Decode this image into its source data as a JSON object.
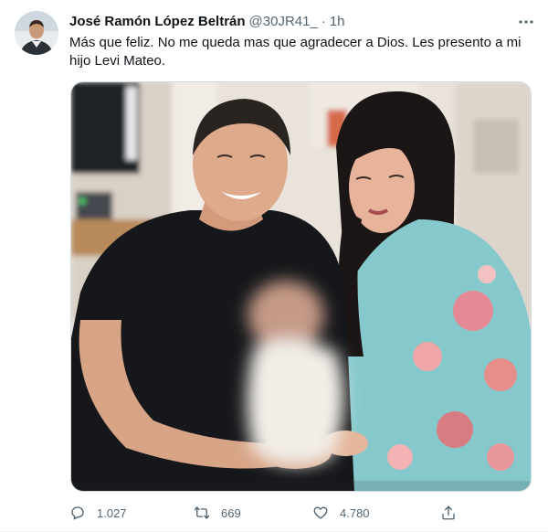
{
  "tweet": {
    "author_name": "José Ramón López Beltrán",
    "handle": "@30JR41_",
    "separator": "·",
    "time": "1h",
    "text": "Más que feliz. No me queda mas que agradecer a Dios. Les presento a mi hijo Levi Mateo."
  },
  "actions": {
    "replies": "1.027",
    "retweets": "669",
    "likes": "4.780"
  },
  "icons": {
    "more": "more-dots-icon",
    "reply": "reply-icon",
    "retweet": "retweet-icon",
    "like": "heart-icon",
    "share": "share-icon"
  },
  "colors": {
    "text_primary": "#0f1419",
    "text_secondary": "#536471",
    "border": "#cfd9de"
  }
}
